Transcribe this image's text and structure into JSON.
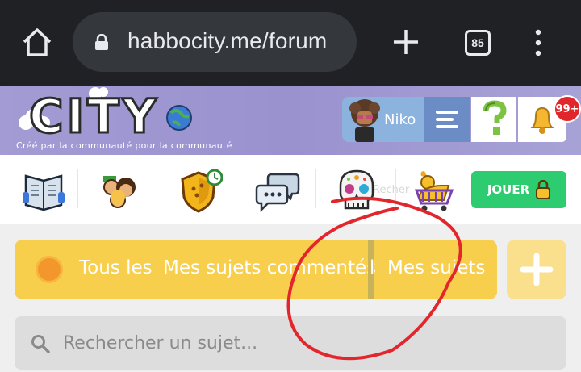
{
  "browser": {
    "url": "habbocity.me/forum",
    "tab_count": "85",
    "icons": [
      "home-icon",
      "lock-icon",
      "plus-icon",
      "tabs-icon",
      "more-vert-icon"
    ]
  },
  "header": {
    "logo_text": "CITY",
    "tagline": "Créé par la communauté pour la communauté",
    "user_name": "Niko",
    "notification_count": "99+",
    "colors": {
      "header": "#9f98d2",
      "user_box": "#8bb3de",
      "menu_button": "#6c8cc6",
      "badge": "#e0262a"
    }
  },
  "nav": {
    "icons": [
      "newspaper-icon",
      "players-icon",
      "badge-shield-icon",
      "chat-bubbles-icon",
      "skull-icon",
      "shop-cart-icon"
    ],
    "hidden_label": "Recher",
    "play_label": "JOUER"
  },
  "filters": {
    "all_topics_label": "Tous les s",
    "commented_label": "Mes sujets commentés",
    "fragment_label": "l",
    "my_topics_label": "Mes sujets",
    "accent": "#f8cf4d"
  },
  "search": {
    "placeholder": "Rechercher un sujet..."
  }
}
